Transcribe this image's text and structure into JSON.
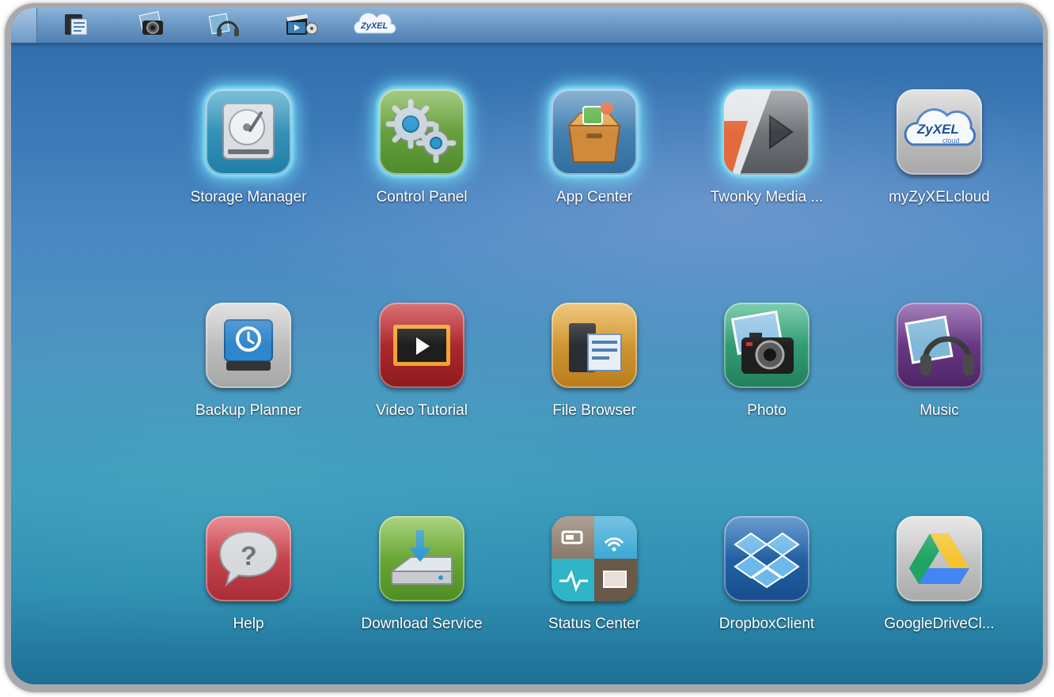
{
  "taskbar": {
    "icons": [
      {
        "name": "file-browser-icon"
      },
      {
        "name": "photo-icon"
      },
      {
        "name": "music-icon"
      },
      {
        "name": "video-icon"
      },
      {
        "name": "zyxel-cloud-icon",
        "text": "ZyXEL"
      }
    ]
  },
  "apps": [
    {
      "label": "Storage Manager",
      "icon": "hard-drive-icon",
      "color": "#2f8fb3",
      "highlighted": true
    },
    {
      "label": "Control Panel",
      "icon": "gears-icon",
      "color": "#5e9b3a",
      "highlighted": true
    },
    {
      "label": "App Center",
      "icon": "package-box-icon",
      "color": "#3e7fae",
      "highlighted": true
    },
    {
      "label": "Twonky Media ...",
      "icon": "media-play-icon",
      "color": "#6b6f74",
      "highlighted": true
    },
    {
      "label": "myZyXELcloud",
      "icon": "zyxel-cloud-icon",
      "color": "#b8b8b8",
      "highlighted": false,
      "logo_text": "ZyXEL",
      "logo_sub": "cloud"
    },
    {
      "label": "Backup Planner",
      "icon": "backup-drive-icon",
      "color": "#bdbdbd",
      "highlighted": false
    },
    {
      "label": "Video Tutorial",
      "icon": "video-tutorial-icon",
      "color": "#b3262a",
      "highlighted": false
    },
    {
      "label": "File Browser",
      "icon": "file-browser-icon",
      "color": "#d69a2e",
      "highlighted": false
    },
    {
      "label": "Photo",
      "icon": "camera-icon",
      "color": "#2fa37a",
      "highlighted": false
    },
    {
      "label": "Music",
      "icon": "headphones-icon",
      "color": "#6a3a8a",
      "highlighted": false
    },
    {
      "label": "Help",
      "icon": "help-bubble-icon",
      "color": "#c8434f",
      "highlighted": false
    },
    {
      "label": "Download Service",
      "icon": "download-icon",
      "color": "#66a33a",
      "highlighted": false
    },
    {
      "label": "Status Center",
      "icon": "status-grid-icon",
      "color": "#7a6a5a",
      "highlighted": false
    },
    {
      "label": "DropboxClient",
      "icon": "dropbox-icon",
      "color": "#1f5fa4",
      "highlighted": false
    },
    {
      "label": "GoogleDriveCl...",
      "icon": "google-drive-icon",
      "color": "#c9c9c9",
      "highlighted": false
    }
  ]
}
